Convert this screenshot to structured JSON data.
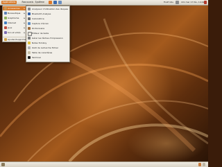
{
  "top_panel": {
    "menus": [
      "Applications",
      "Raccourcis",
      "Système"
    ],
    "tray": {
      "user": "Firefi Ubu",
      "datetime": "dim mar 17 fév, 14:42"
    }
  },
  "applications_menu": {
    "items": [
      {
        "label": "Accessoires",
        "icon": "accessories-icon",
        "active": true
      },
      {
        "label": "Bureautique",
        "icon": "office-icon",
        "active": false
      },
      {
        "label": "Graphisme",
        "icon": "graphics-icon",
        "active": false
      },
      {
        "label": "Internet",
        "icon": "internet-icon",
        "active": false
      },
      {
        "label": "Jeux",
        "icon": "games-icon",
        "active": false
      },
      {
        "label": "Son et vidéo",
        "icon": "sound-video-icon",
        "active": false
      },
      {
        "label": "Ajouter/Supprimer...",
        "icon": "add-remove-icon",
        "active": false
      }
    ]
  },
  "accessories_menu": {
    "items": [
      {
        "label": "Analyseur d'utilisation des disques",
        "icon": "disk-usage-icon"
      },
      {
        "label": "Bluetooth Analyse",
        "icon": "bluetooth-icon"
      },
      {
        "label": "Calculatrice",
        "icon": "calculator-icon"
      },
      {
        "label": "Capture d'écran",
        "icon": "screenshot-icon"
      },
      {
        "label": "Dictionnaire",
        "icon": "dictionary-icon"
      },
      {
        "label": "Éditeur de texte",
        "icon": "text-editor-icon"
      },
      {
        "label": "Gérer les tâches d'impression",
        "icon": "printer-icon"
      },
      {
        "label": "Notes Tomboy",
        "icon": "tomboy-icon"
      },
      {
        "label": "Outil de recherche fichier",
        "icon": "search-icon"
      },
      {
        "label": "Table de caractères",
        "icon": "charmap-icon"
      },
      {
        "label": "Terminal",
        "icon": "terminal-icon"
      }
    ]
  },
  "colors": {
    "accent": "#d77b2c",
    "panel": "#e6e1d6",
    "wallpaper": "#6a3510"
  }
}
